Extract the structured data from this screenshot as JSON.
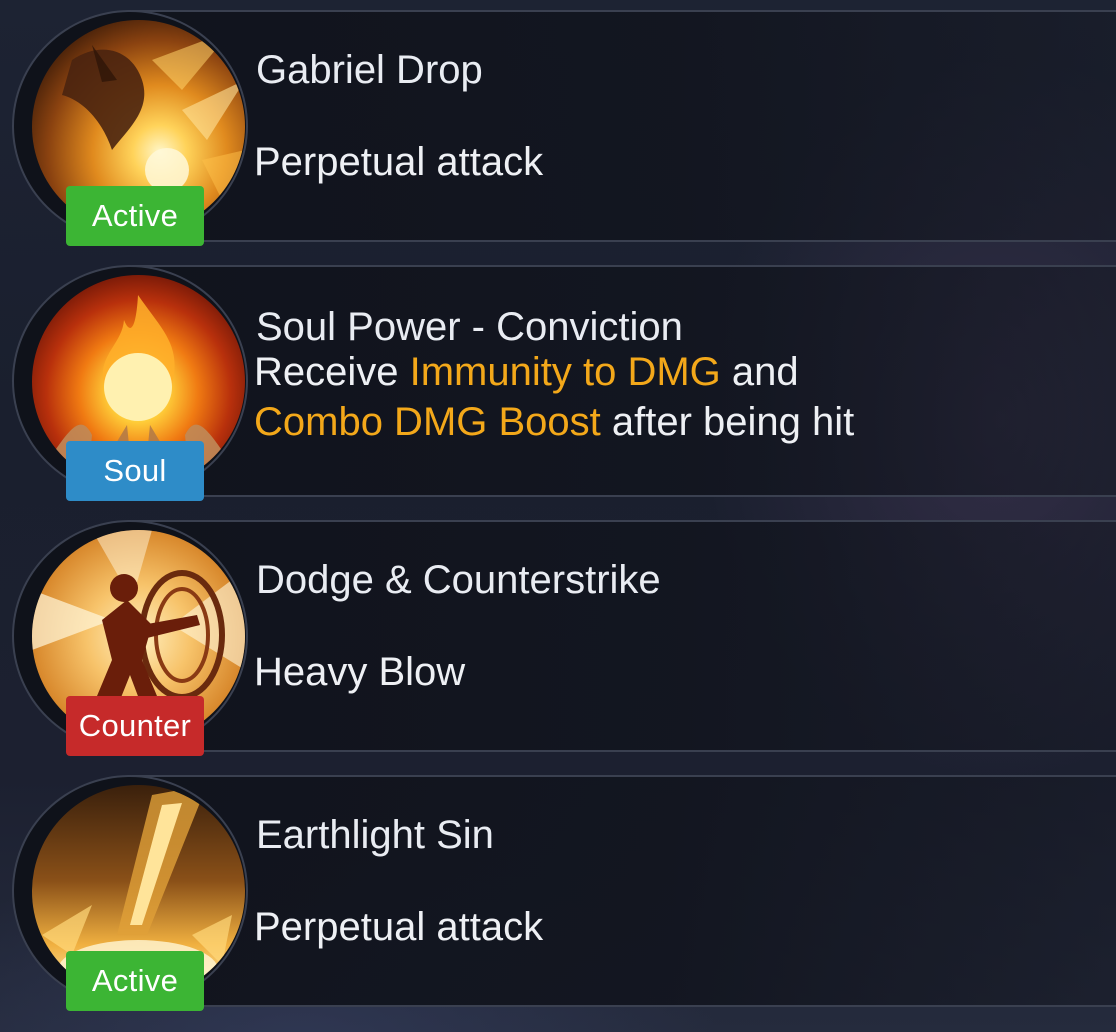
{
  "skills": [
    {
      "name": "Gabriel Drop",
      "badge": "Active",
      "badge_color": "#3cb534",
      "icon": "flame-fist-icon",
      "description": "Perpetual attack"
    },
    {
      "name": "Soul Power - Conviction",
      "badge": "Soul",
      "badge_color": "#2e8cc8",
      "icon": "flaming-orb-icon",
      "description_parts": {
        "p1": "Receive ",
        "h1": "Immunity to DMG",
        "p2": " and ",
        "h2": "Combo DMG Boost",
        "p3": " after being hit"
      },
      "highlight_color": "#f3a81a"
    },
    {
      "name": "Dodge & Counterstrike",
      "badge": "Counter",
      "badge_color": "#c62a2a",
      "icon": "counterstrike-figure-icon",
      "description": "Heavy Blow"
    },
    {
      "name": "Earthlight Sin",
      "badge": "Active",
      "badge_color": "#3cb534",
      "icon": "light-spear-icon",
      "description": "Perpetual attack"
    }
  ]
}
